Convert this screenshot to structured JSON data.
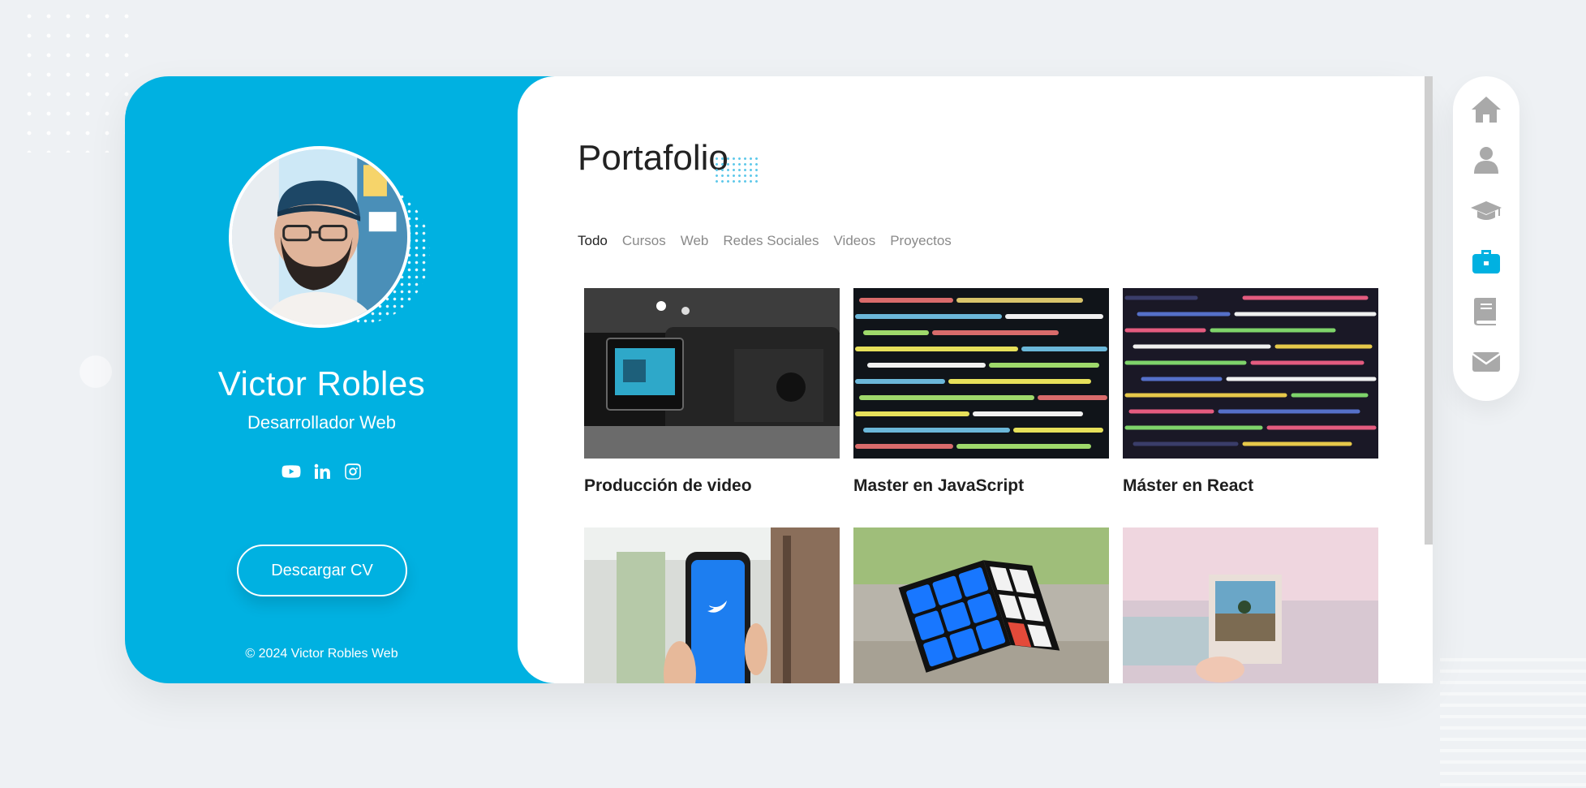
{
  "profile": {
    "name": "Victor Robles",
    "role": "Desarrollador Web",
    "cv_button": "Descargar CV",
    "copyright": "© 2024 Victor Robles Web",
    "socials": [
      "youtube-icon",
      "linkedin-icon",
      "instagram-icon"
    ]
  },
  "portfolio": {
    "title": "Portafolio",
    "filters": [
      "Todo",
      "Cursos",
      "Web",
      "Redes Sociales",
      "Videos",
      "Proyectos"
    ],
    "active_filter": "Todo",
    "items": [
      {
        "title": "Producción de video"
      },
      {
        "title": "Master en JavaScript"
      },
      {
        "title": "Máster en React"
      },
      {
        "title": ""
      },
      {
        "title": ""
      },
      {
        "title": ""
      }
    ]
  },
  "nav": {
    "items": [
      "home-icon",
      "user-icon",
      "graduation-cap-icon",
      "briefcase-icon",
      "book-icon",
      "envelope-icon"
    ],
    "active": "briefcase-icon"
  },
  "colors": {
    "accent": "#00b1e1",
    "background": "#eef1f4",
    "text_dark": "#222222",
    "text_muted": "#8a8a8a",
    "nav_icon": "#a9a9a9"
  }
}
